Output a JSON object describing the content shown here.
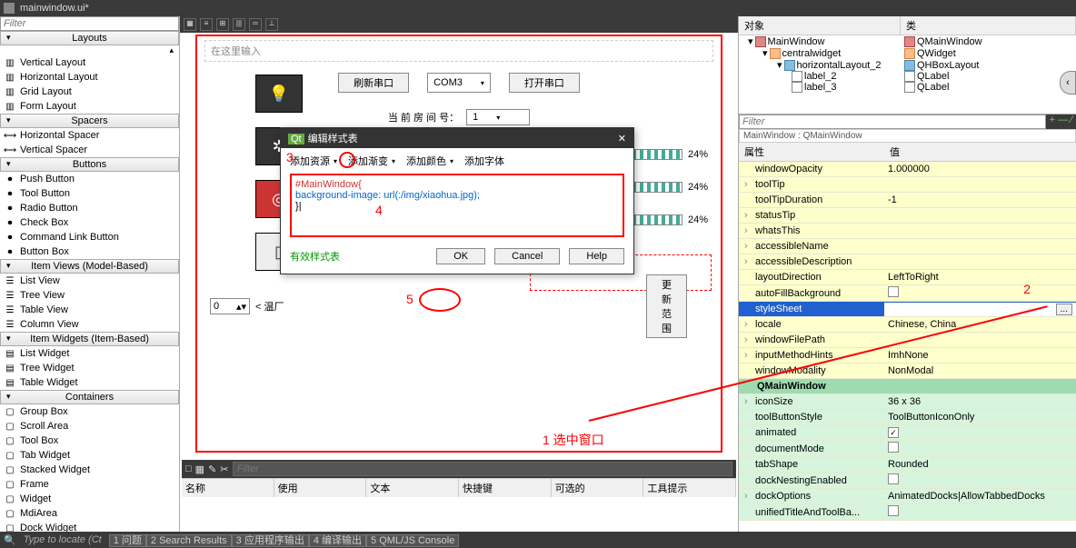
{
  "titlebar": {
    "filename": "mainwindow.ui*"
  },
  "left": {
    "filter": "Filter",
    "sections": {
      "layouts": {
        "title": "Layouts",
        "items": [
          "Vertical Layout",
          "Horizontal Layout",
          "Grid Layout",
          "Form Layout"
        ]
      },
      "spacers": {
        "title": "Spacers",
        "items": [
          "Horizontal Spacer",
          "Vertical Spacer"
        ]
      },
      "buttons": {
        "title": "Buttons",
        "items": [
          "Push Button",
          "Tool Button",
          "Radio Button",
          "Check Box",
          "Command Link Button",
          "Button Box"
        ]
      },
      "itemviews": {
        "title": "Item Views (Model-Based)",
        "items": [
          "List View",
          "Tree View",
          "Table View",
          "Column View"
        ]
      },
      "itemwidgets": {
        "title": "Item Widgets (Item-Based)",
        "items": [
          "List Widget",
          "Tree Widget",
          "Table Widget"
        ]
      },
      "containers": {
        "title": "Containers",
        "items": [
          "Group Box",
          "Scroll Area",
          "Tool Box",
          "Tab Widget",
          "Stacked Widget",
          "Frame",
          "Widget",
          "MdiArea",
          "Dock Widget"
        ]
      }
    }
  },
  "canvas": {
    "placeholder": "在这里输入",
    "refresh_btn": "刷新串口",
    "com_value": "COM3",
    "open_btn": "打开串口",
    "room_label": "当 前 房 间 号：",
    "room_value": "1",
    "progress_vals": [
      "24%",
      "24%",
      "24%"
    ],
    "temp_label": "< 温厂",
    "update_btn": "更新范围",
    "spin_value": "0",
    "anno1": "1 选中窗口",
    "anno2": "2",
    "anno3": "3",
    "anno4": "4",
    "anno5": "5"
  },
  "dialog": {
    "title": "编辑样式表",
    "add_resource": "添加资源",
    "add_gradient": "添加渐变",
    "add_color": "添加颜色",
    "add_font": "添加字体",
    "code_line1": "#MainWindow{",
    "code_line2": "    background-image: url(:/img/xiaohua.jpg);",
    "code_line3": "}",
    "valid_label": "有效样式表",
    "ok": "OK",
    "cancel": "Cancel",
    "help": "Help"
  },
  "object_tree": {
    "hdr_obj": "对象",
    "hdr_cls": "类",
    "rows": [
      {
        "indent": 0,
        "name": "MainWindow",
        "cls": "QMainWindow",
        "ico": "win"
      },
      {
        "indent": 1,
        "name": "centralwidget",
        "cls": "QWidget",
        "ico": "wid"
      },
      {
        "indent": 2,
        "name": "horizontalLayout_2",
        "cls": "QHBoxLayout",
        "ico": "lay"
      },
      {
        "indent": 3,
        "name": "label_2",
        "cls": "QLabel",
        "ico": "lbl"
      },
      {
        "indent": 3,
        "name": "label_3",
        "cls": "QLabel",
        "ico": "lbl"
      }
    ]
  },
  "prop": {
    "filter": "Filter",
    "crumb": "MainWindow : QMainWindow",
    "hdr_prop": "属性",
    "hdr_val": "值",
    "rows": [
      {
        "k": "windowOpacity",
        "v": "1.000000",
        "cls": "yellow"
      },
      {
        "k": "toolTip",
        "v": "",
        "cls": "yellow expand"
      },
      {
        "k": "toolTipDuration",
        "v": "-1",
        "cls": "yellow"
      },
      {
        "k": "statusTip",
        "v": "",
        "cls": "yellow expand"
      },
      {
        "k": "whatsThis",
        "v": "",
        "cls": "yellow expand"
      },
      {
        "k": "accessibleName",
        "v": "",
        "cls": "yellow expand"
      },
      {
        "k": "accessibleDescription",
        "v": "",
        "cls": "yellow expand"
      },
      {
        "k": "layoutDirection",
        "v": "LeftToRight",
        "cls": "yellow"
      },
      {
        "k": "autoFillBackground",
        "v": "☐",
        "cls": "yellow"
      },
      {
        "k": "styleSheet",
        "v": "",
        "cls": "sel-row",
        "dots": true
      },
      {
        "k": "locale",
        "v": "Chinese, China",
        "cls": "yellow expand"
      },
      {
        "k": "windowFilePath",
        "v": "",
        "cls": "yellow expand"
      },
      {
        "k": "inputMethodHints",
        "v": "ImhNone",
        "cls": "yellow expand"
      },
      {
        "k": "windowModality",
        "v": "NonModal",
        "cls": "yellow"
      },
      {
        "k": "QMainWindow",
        "v": "",
        "cls": "group"
      },
      {
        "k": "iconSize",
        "v": "36 x 36",
        "cls": "green expand"
      },
      {
        "k": "toolButtonStyle",
        "v": "ToolButtonIconOnly",
        "cls": "green"
      },
      {
        "k": "animated",
        "v": "☑",
        "cls": "green"
      },
      {
        "k": "documentMode",
        "v": "☐",
        "cls": "green"
      },
      {
        "k": "tabShape",
        "v": "Rounded",
        "cls": "green"
      },
      {
        "k": "dockNestingEnabled",
        "v": "☐",
        "cls": "green"
      },
      {
        "k": "dockOptions",
        "v": "AnimatedDocks|AllowTabbedDocks",
        "cls": "green expand"
      },
      {
        "k": "unifiedTitleAndToolBa...",
        "v": "☐",
        "cls": "green"
      }
    ]
  },
  "bottom_filter": "Filter",
  "col_hdrs": [
    "名称",
    "使用",
    "文本",
    "快捷键",
    "可选的",
    "工具提示"
  ],
  "status": {
    "locator": "Type to locate (Ct",
    "tabs": [
      "1 问题",
      "2 Search Results",
      "3 应用程序输出",
      "4 编译输出",
      "5 QML/JS Console"
    ]
  }
}
